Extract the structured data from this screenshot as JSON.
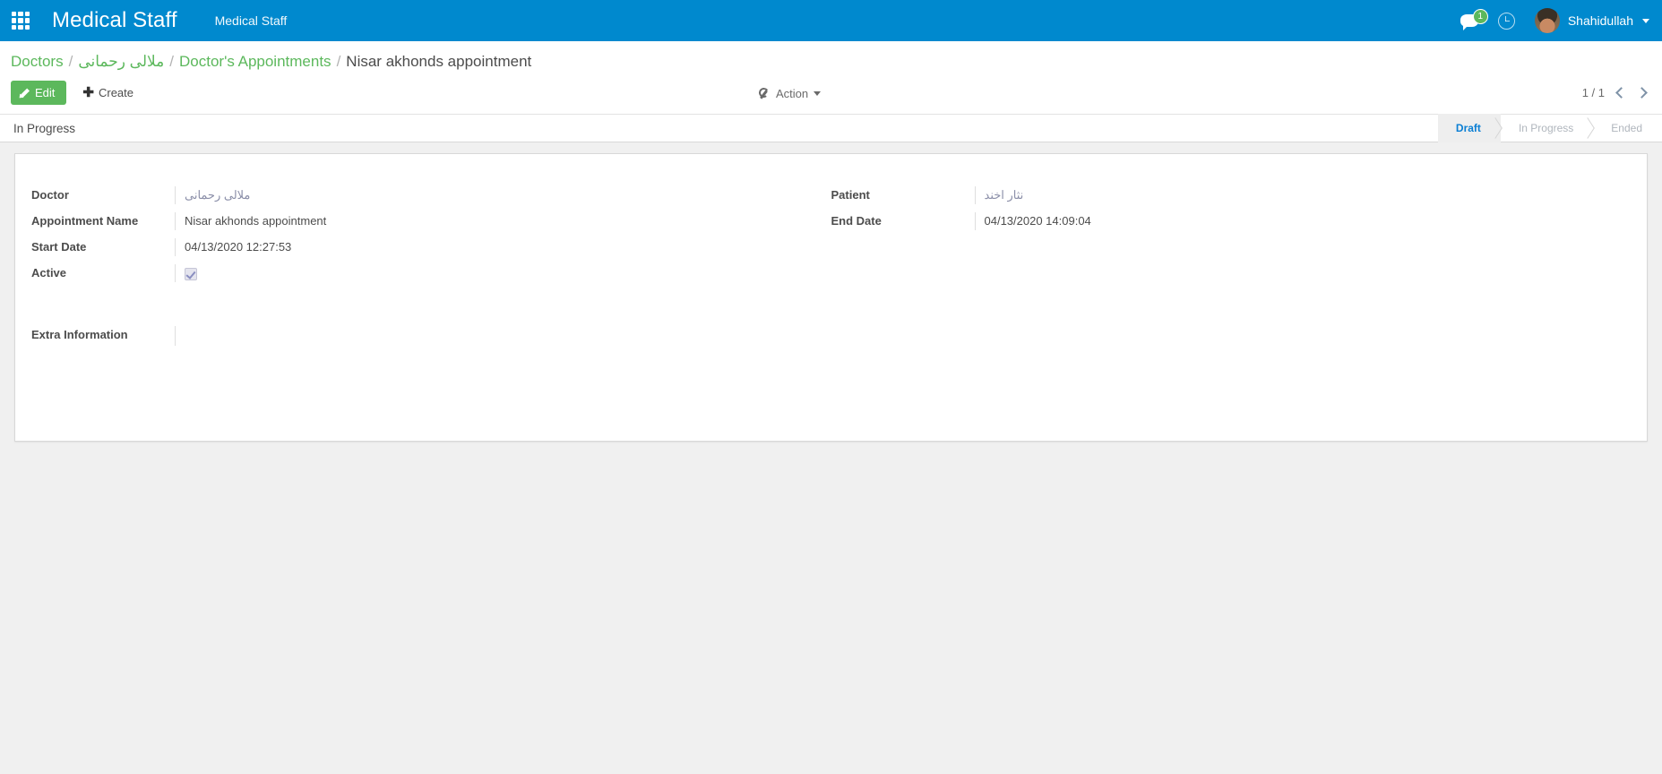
{
  "navbar": {
    "apps_icon": "apps-grid-icon",
    "brand": "Medical Staff",
    "menu_label": "Medical Staff",
    "messages_icon": "chat-bubble-icon",
    "messages_count": "1",
    "activity_icon": "clock-icon",
    "user_name": "Shahidullah",
    "brand_color": "#0089ce",
    "badge_color": "#5cb85c"
  },
  "breadcrumb": {
    "items": [
      {
        "label": "Doctors",
        "type": "link"
      },
      {
        "label": "ملالی رحمانی",
        "type": "link",
        "rtl": true
      },
      {
        "label": "Doctor's Appointments",
        "type": "link"
      },
      {
        "label": "Nisar akhonds appointment",
        "type": "current"
      }
    ],
    "separator": "/",
    "link_color": "#5cb85c"
  },
  "control_panel": {
    "edit_label": "Edit",
    "edit_icon": "pencil-icon",
    "create_label": "Create",
    "create_icon": "plus-icon",
    "action_label": "Action",
    "action_icon": "wrench-icon",
    "pager_text": "1 / 1",
    "prev_icon": "chevron-left-icon",
    "next_icon": "chevron-right-icon"
  },
  "status": {
    "title": "In Progress",
    "stages": [
      {
        "label": "Draft",
        "active": true
      },
      {
        "label": "In Progress",
        "active": false
      },
      {
        "label": "Ended",
        "active": false
      }
    ],
    "active_color": "#0b7fd4"
  },
  "form": {
    "left_fields": [
      {
        "label": "Doctor",
        "value": "ملالی رحمانی",
        "kind": "link",
        "rtl": true
      },
      {
        "label": "Appointment Name",
        "value": "Nisar akhonds appointment",
        "kind": "text"
      },
      {
        "label": "Start Date",
        "value": "04/13/2020 12:27:53",
        "kind": "text"
      },
      {
        "label": "Active",
        "value": "",
        "kind": "checkbox",
        "checked": true
      }
    ],
    "right_fields": [
      {
        "label": "Patient",
        "value": "نثار اخند",
        "kind": "link",
        "rtl": true
      },
      {
        "label": "End Date",
        "value": "04/13/2020 14:09:04",
        "kind": "text"
      }
    ],
    "extra": {
      "label": "Extra Information",
      "value": ""
    }
  }
}
